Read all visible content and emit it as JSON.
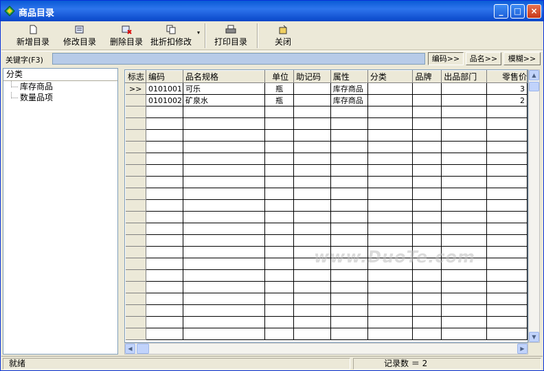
{
  "window": {
    "title": "商品目录",
    "minimize": "_",
    "maximize": "□",
    "close": "×"
  },
  "toolbar": {
    "new": "新增目录",
    "edit": "修改目录",
    "delete": "删除目录",
    "batch": "批折扣修改",
    "print": "打印目录",
    "close": "关闭"
  },
  "keyword": {
    "label": "关键字(F3)",
    "value": "",
    "buttons": [
      "编码>>",
      "品名>>",
      "模糊>>"
    ]
  },
  "tree": {
    "header": "分类",
    "items": [
      "库存商品",
      "数量品项"
    ]
  },
  "grid": {
    "columns": [
      "标志",
      "编码",
      "品名规格",
      "单位",
      "助记码",
      "属性",
      "分类",
      "品牌",
      "出品部门",
      "零售价"
    ],
    "rows": [
      {
        "flag": ">>",
        "code": "0101001",
        "name": "可乐",
        "unit": "瓶",
        "mnemonic": "",
        "attr": "库存商品",
        "category": "",
        "brand": "",
        "dept": "",
        "price": "3"
      },
      {
        "flag": "",
        "code": "0101002",
        "name": "矿泉水",
        "unit": "瓶",
        "mnemonic": "",
        "attr": "库存商品",
        "category": "",
        "brand": "",
        "dept": "",
        "price": "2"
      }
    ]
  },
  "status": {
    "left": "就绪",
    "count": "记录数 ＝ 2"
  },
  "watermark": "www.DuoTe.com",
  "colors": {
    "titlebar": "#0a5bd6",
    "keyinput": "#b7cbe8",
    "chrome": "#ece9d8"
  }
}
